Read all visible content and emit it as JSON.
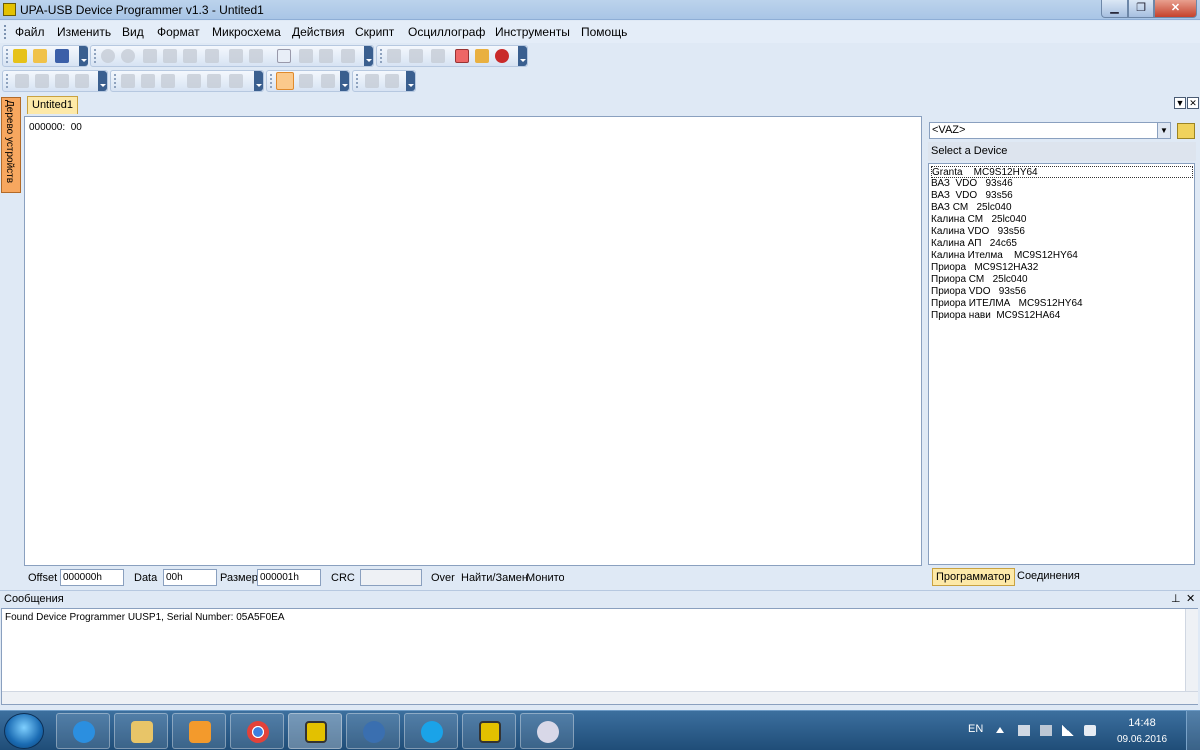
{
  "window": {
    "title": "UPA-USB Device Programmer v1.3 - Untited1",
    "controls": {
      "minimize": "▁",
      "maximize": "❐",
      "close": "✕"
    }
  },
  "menu": [
    "Файл",
    "Изменить",
    "Вид",
    "Формат",
    "Микросхема",
    "Действия",
    "Скрипт",
    "Осциллограф",
    "Инструменты",
    "Помощь"
  ],
  "document_tab": {
    "label": "Untited1",
    "arrow": "▼",
    "close": "✕"
  },
  "side_tab": "Дерево устройств",
  "editor": {
    "hex_line": "000000:  00"
  },
  "right_panel": {
    "device_group": "<VAZ>",
    "select_label": "Select a Device",
    "devices": [
      "Granta    MC9S12HY64",
      "ВАЗ  VDO   93s46",
      "ВАЗ  VDO   93s56",
      "ВАЗ СМ   25lc040",
      "Калина СМ   25lc040",
      "Калина VDO   93s56",
      "Калина АП   24c65",
      "Калина Ителма    MC9S12HY64",
      "Приора   MC9S12HA32",
      "Приора СМ   25lc040",
      "Приора VDO   93s56",
      "Приора ИТЕЛМА   MC9S12HY64",
      "Приора нави  MC9S12HA64"
    ],
    "selected_index": 0,
    "tabs": {
      "programmer": "Программатор",
      "connections": "Соединения"
    }
  },
  "status": {
    "offset_label": "Offset",
    "offset_value": "000000h",
    "data_label": "Data",
    "data_value": "00h",
    "size_label": "Размер",
    "size_value": "000001h",
    "crc_label": "CRC",
    "crc_value": "",
    "over_label": "Over",
    "find_replace_label": "Найти/Замен",
    "monitor_label": "Монитор"
  },
  "messages": {
    "title": "Сообщения",
    "pin": "⊥",
    "close": "✕",
    "text": "Found Device Programmer UUSP1, Serial Number: 05A5F0EA"
  },
  "taskbar": {
    "apps": [
      "start-orb",
      "internet-explorer",
      "file-explorer",
      "media-player",
      "chrome",
      "upa-programmer",
      "thunderbird",
      "skype",
      "upa-programmer-2",
      "paint"
    ],
    "language": "EN",
    "time": "14:48",
    "date": "09.06.2016"
  },
  "colors": {
    "accent_tab": "#fde9a8",
    "side_tab": "#f7a75f",
    "taskbar": "#1f4d78"
  }
}
